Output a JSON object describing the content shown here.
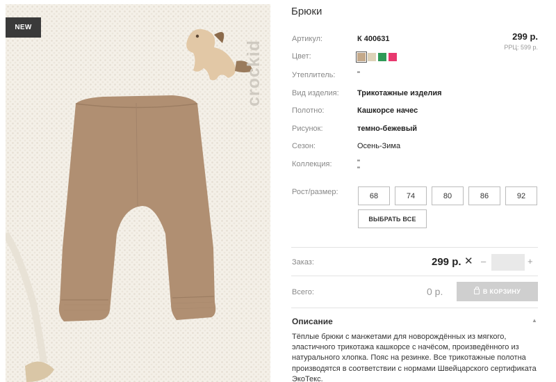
{
  "product": {
    "title": "Брюки",
    "badge": "NEW",
    "watermark": "crockid",
    "price": "299 р.",
    "rrp": "РРЦ: 599 р."
  },
  "specs": {
    "sku_label": "Артикул:",
    "sku_value": "К 400631",
    "color_label": "Цвет:",
    "insulation_label": "Утеплитель:",
    "insulation_value": "\"",
    "type_label": "Вид изделия:",
    "type_value": "Трикотажные изделия",
    "fabric_label": "Полотно:",
    "fabric_value": "Кашкорсе начес",
    "pattern_label": "Рисунок:",
    "pattern_value": "темно-бежевый",
    "season_label": "Сезон:",
    "season_value": "Осень-Зима",
    "collection_label": "Коллекция:",
    "collection_value_1": "\"",
    "collection_value_2": "\""
  },
  "swatches": [
    {
      "name": "dark-beige",
      "color": "#c4a98a",
      "selected": true
    },
    {
      "name": "light-beige",
      "color": "#ddd2b8",
      "selected": false
    },
    {
      "name": "green",
      "color": "#2f9a57",
      "selected": false
    },
    {
      "name": "pink",
      "color": "#e8386e",
      "selected": false
    }
  ],
  "sizes": {
    "label": "Рост/размер:",
    "options": [
      "68",
      "74",
      "80",
      "86",
      "92"
    ],
    "select_all": "ВЫБРАТЬ ВСЕ"
  },
  "order": {
    "label": "Заказ:",
    "price": "299 р.",
    "times": "✕",
    "minus": "–",
    "plus": "+",
    "quantity": ""
  },
  "total": {
    "label": "Всего:",
    "value": "0 р.",
    "cart_button": "В КОРЗИНУ"
  },
  "description": {
    "heading": "Описание",
    "caret": "▲",
    "text": "Тёплые брюки с манжетами для новорождённых из мягкого, эластичного трикотажа кашкорсе с начёсом, произведённого из натурального хлопка. Пояс на резинке. Все трикотажные полотна производятся в соответствии с нормами Швейцарского сертификата ЭкоТекс."
  },
  "colors": {
    "pants": "#b08f72",
    "text_label": "#888888",
    "button_disabled": "#cfcfcf",
    "badge_bg": "#3a3a3a"
  }
}
